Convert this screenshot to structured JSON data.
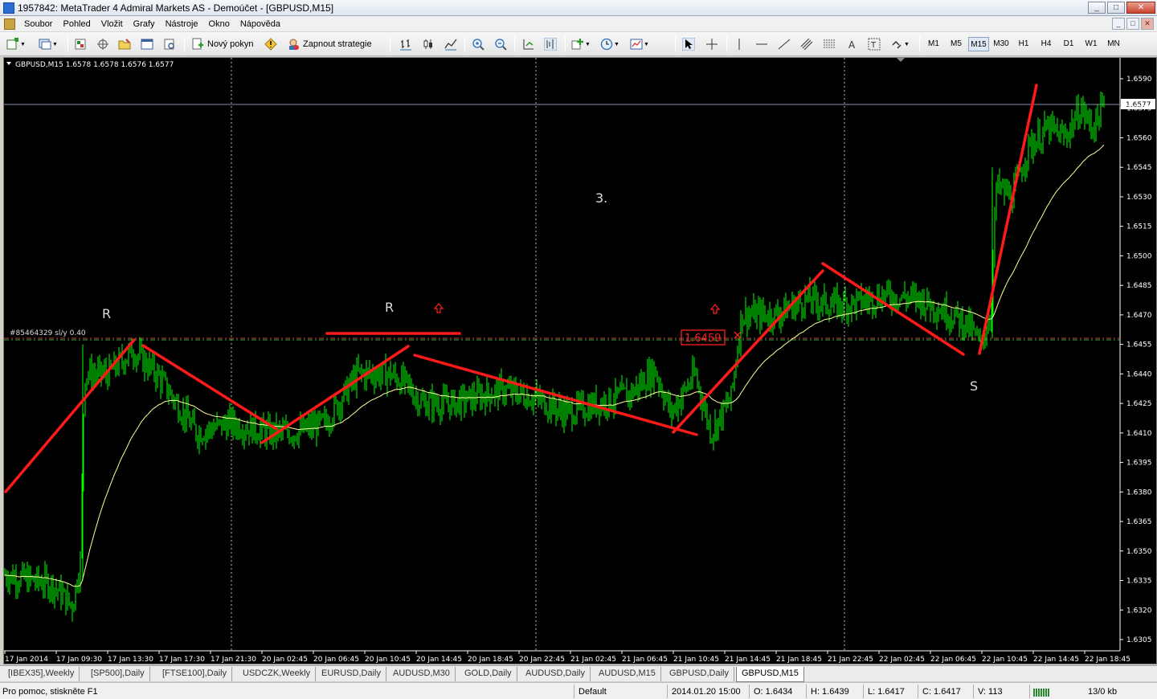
{
  "window": {
    "title": "1957842: MetaTrader 4 Admiral Markets AS - Demoúčet - [GBPUSD,M15]",
    "buttons": [
      "_",
      "□",
      "✕"
    ]
  },
  "menu": {
    "items": [
      "Soubor",
      "Pohled",
      "Vložit",
      "Grafy",
      "Nástroje",
      "Okno",
      "Nápověda"
    ]
  },
  "toolbar": {
    "new_order_label": "Nový pokyn",
    "strategy_label": "Zapnout strategie",
    "timeframes": [
      "M1",
      "M5",
      "M15",
      "M30",
      "H1",
      "H4",
      "D1",
      "W1",
      "MN"
    ],
    "active_timeframe": "M15"
  },
  "chart": {
    "info_line": "GBPUSD,M15  1.6578 1.6578 1.6576 1.6577",
    "order_label": "#85464329 sl/y 0.40",
    "price_box_label": "1.6459",
    "current_price_label": "1.6577",
    "annotation_r1": "R",
    "annotation_r2": "R",
    "annotation_3": "3.",
    "annotation_s": "S",
    "y_axis_ticks": [
      "1.6590",
      "1.6575",
      "1.6560",
      "1.6545",
      "1.6530",
      "1.6515",
      "1.6500",
      "1.6485",
      "1.6470",
      "1.6455",
      "1.6440",
      "1.6425",
      "1.6410",
      "1.6395",
      "1.6380",
      "1.6365",
      "1.6350",
      "1.6335",
      "1.6320",
      "1.6305"
    ],
    "x_axis_ticks": [
      "17 Jan 2014",
      "17 Jan 09:30",
      "17 Jan 13:30",
      "17 Jan 17:30",
      "17 Jan 21:30",
      "20 Jan 02:45",
      "20 Jan 06:45",
      "20 Jan 10:45",
      "20 Jan 14:45",
      "20 Jan 18:45",
      "20 Jan 22:45",
      "21 Jan 02:45",
      "21 Jan 06:45",
      "21 Jan 10:45",
      "21 Jan 14:45",
      "21 Jan 18:45",
      "21 Jan 22:45",
      "22 Jan 02:45",
      "22 Jan 06:45",
      "22 Jan 10:45",
      "22 Jan 14:45",
      "22 Jan 18:45"
    ],
    "colors": {
      "background": "#000000",
      "candles": "#00ff00",
      "ma": "#ffff99",
      "trendlines": "#ff0000",
      "grid_vertical": "#c0c0c0",
      "axis_text": "#ffffff"
    }
  },
  "tabs": {
    "items": [
      "[IBEX35],Weekly",
      "[SP500],Daily",
      "[FTSE100],Daily",
      "USDCZK,Weekly",
      "EURUSD,Daily",
      "AUDUSD,M30",
      "GOLD,Daily",
      "AUDUSD,Daily",
      "AUDUSD,M15",
      "GBPUSD,Daily",
      "GBPUSD,M15"
    ],
    "active": "GBPUSD,M15"
  },
  "status": {
    "help": "Pro pomoc, stiskněte F1",
    "profile": "Default",
    "datetime": "2014.01.20 15:00",
    "open": "O: 1.6434",
    "high": "H: 1.6439",
    "low": "L: 1.6417",
    "close": "C: 1.6417",
    "volume": "V: 113",
    "traffic": "13/0 kb"
  }
}
